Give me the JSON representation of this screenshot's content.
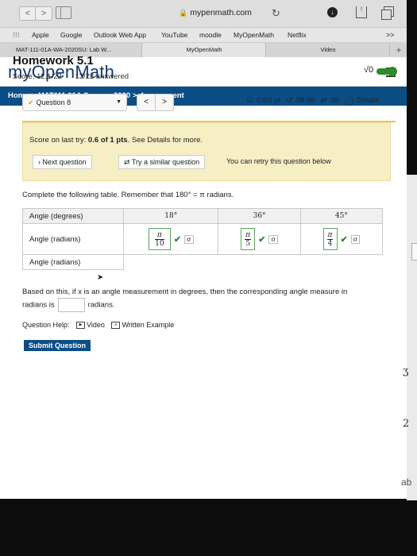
{
  "browser": {
    "url": "mypenmath.com",
    "favorites": [
      "Apple",
      "Google",
      "Outlook Web App",
      "YouTube",
      "moodle",
      "MyOpenMath",
      "Netflix"
    ],
    "favorites_more": ">>",
    "tabs": [
      "MAT-111-01A-WA-2020SU: Lab W...",
      "MyOpenMath",
      "Video"
    ],
    "new_tab": "+"
  },
  "site": {
    "logo": "myOpenMath",
    "breadcrumb": [
      "Home",
      "MAT111 01A Summer2020",
      "Assessment"
    ]
  },
  "homework": {
    "title": "Homework 5.1",
    "score": "Score: 12.1/22",
    "answered": "13/22 answered",
    "sqrt_label": "√0"
  },
  "question": {
    "label": "Question 8",
    "points": "0.6/1 pt",
    "attempts": "98-99",
    "retries": "99",
    "details_label": "Details"
  },
  "notice": {
    "prefix": "Score on last try: ",
    "score": "0.6 of 1 pts",
    "suffix": ". See Details for more.",
    "next_label": "Next question",
    "similar_label": "Try a similar question",
    "retry_text": "You can retry this question below"
  },
  "problem": {
    "instruction": "Complete the following table. Remember that 180° = π radians.",
    "table": {
      "row_labels": [
        "Angle (degrees)",
        "Angle (radians)",
        "Angle (radians)"
      ],
      "degrees": [
        "18°",
        "36°",
        "45°"
      ],
      "radians": [
        {
          "num": "π",
          "den": "10"
        },
        {
          "num": "π",
          "den": "5"
        },
        {
          "num": "π",
          "den": "4"
        }
      ]
    },
    "based_text_1": "Based on this, if x is an angle measurement in degrees, then the corresponding angle measure in",
    "based_text_2": "radians is",
    "based_text_3": "radians."
  },
  "help": {
    "label": "Question Help:",
    "video": "Video",
    "written": "Written Example"
  },
  "submit_label": "Submit Question",
  "edge_chars": [
    "ʒ",
    "2",
    "ab"
  ]
}
